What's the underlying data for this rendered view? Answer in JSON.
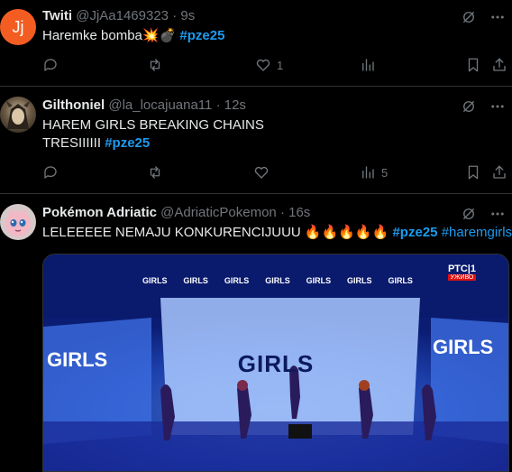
{
  "tweets": [
    {
      "avatar_letter": "Jj",
      "name": "Twiti",
      "handle": "@JjAa1469323",
      "time": "· 9s",
      "text": "Haremke bomba",
      "emoji": "💥💣",
      "hashtag": "#pze25",
      "likes": "1",
      "views": ""
    },
    {
      "name": "Gilthoniel",
      "handle": "@la_locajuana11",
      "time": "· 12s",
      "line1": "HAREM GIRLS BREAKING CHAINS",
      "line2": "TRESIIIIII",
      "hashtag": "#pze25",
      "likes": "",
      "views": "5"
    },
    {
      "name": "Pokémon Adriatic",
      "handle": "@AdriaticPokemon",
      "time": "· 16s",
      "text": "LELEEEEE NEMAJU KONKURENCIJUUU",
      "emoji": "🔥🔥🔥🔥🔥",
      "hashtag1": "#pze25",
      "hashtag2": "#haremgirls",
      "media": {
        "screen_text": "GIRLS",
        "side_left": "GIRLS",
        "side_right": "GIRLS",
        "banner": [
          "GIRLS",
          "GIRLS",
          "GIRLS",
          "GIRLS",
          "GIRLS",
          "GIRLS",
          "GIRLS"
        ],
        "logo": "РТС|1",
        "live": "УЖИВО"
      }
    }
  ]
}
